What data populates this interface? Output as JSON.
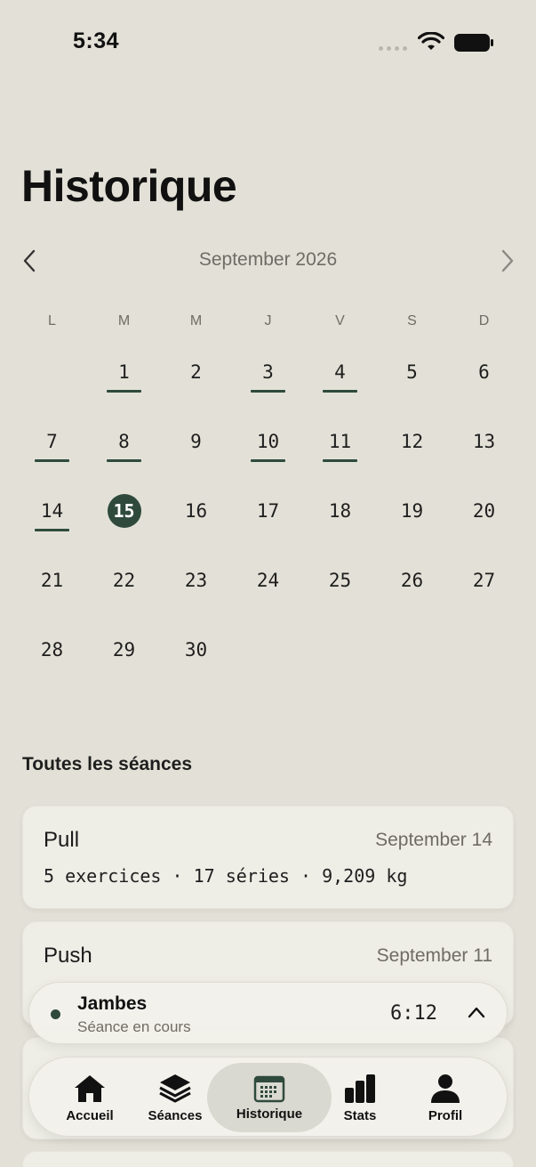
{
  "status_bar": {
    "time": "5:34"
  },
  "page": {
    "title": "Historique"
  },
  "calendar": {
    "month_label": "September 2026",
    "weekdays": [
      "L",
      "M",
      "M",
      "J",
      "V",
      "S",
      "D"
    ],
    "leading_blanks": 1,
    "days_in_month": 30,
    "session_days": [
      1,
      3,
      4,
      7,
      8,
      10,
      11,
      14
    ],
    "selected_day": 15
  },
  "sessions": {
    "section_title": "Toutes les séances",
    "items": [
      {
        "name": "Pull",
        "date": "September 14",
        "meta": "5 exercices · 17 séries · 9,209 kg"
      },
      {
        "name": "Push",
        "date": "September 11"
      }
    ]
  },
  "live_session": {
    "name": "Jambes",
    "status": "Séance en cours",
    "elapsed": "6:12"
  },
  "tab_bar": {
    "accent_color": "#2F4A3D",
    "items": [
      {
        "id": "accueil",
        "label": "Accueil",
        "icon": "home-icon"
      },
      {
        "id": "seances",
        "label": "Séances",
        "icon": "layers-icon"
      },
      {
        "id": "historique",
        "label": "Historique",
        "icon": "calendar-icon",
        "active": true
      },
      {
        "id": "stats",
        "label": "Stats",
        "icon": "bar-chart-icon"
      },
      {
        "id": "profil",
        "label": "Profil",
        "icon": "person-icon"
      }
    ]
  }
}
